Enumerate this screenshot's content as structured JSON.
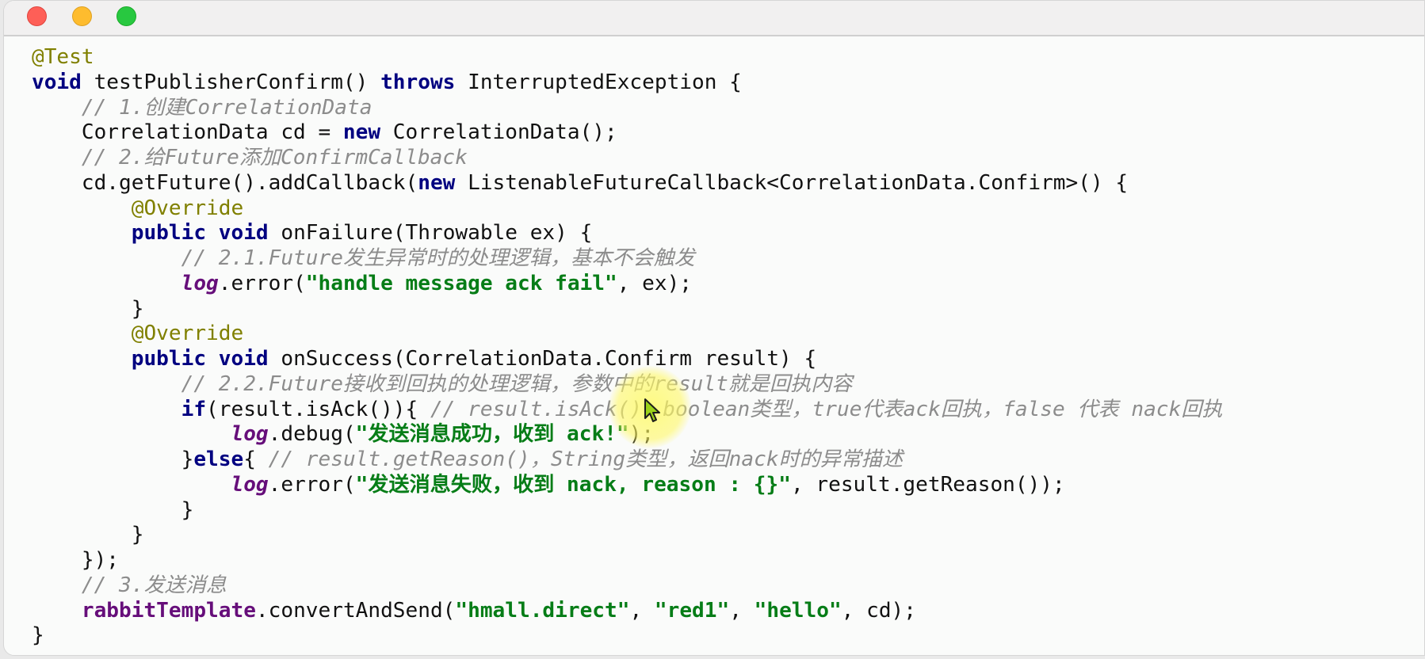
{
  "window": {
    "controls": [
      "close",
      "minimize",
      "maximize"
    ],
    "colors": {
      "close": "#fe5f57",
      "minimize": "#febc2e",
      "maximize": "#28c840"
    }
  },
  "code": {
    "language": "java",
    "lines": [
      [
        {
          "t": "ann",
          "v": "@Test"
        }
      ],
      [
        {
          "t": "kw",
          "v": "void"
        },
        {
          "t": "",
          "v": " testPublisherConfirm() "
        },
        {
          "t": "kw",
          "v": "throws"
        },
        {
          "t": "",
          "v": " InterruptedException {"
        }
      ],
      [
        {
          "t": "",
          "v": "    "
        },
        {
          "t": "cm",
          "v": "// 1.创建CorrelationData"
        }
      ],
      [
        {
          "t": "",
          "v": "    CorrelationData cd = "
        },
        {
          "t": "kw",
          "v": "new"
        },
        {
          "t": "",
          "v": " CorrelationData();"
        }
      ],
      [
        {
          "t": "",
          "v": "    "
        },
        {
          "t": "cm",
          "v": "// 2.给Future添加ConfirmCallback"
        }
      ],
      [
        {
          "t": "",
          "v": "    cd.getFuture().addCallback("
        },
        {
          "t": "kw",
          "v": "new"
        },
        {
          "t": "",
          "v": " ListenableFutureCallback<CorrelationData.Confirm>() {"
        }
      ],
      [
        {
          "t": "",
          "v": "        "
        },
        {
          "t": "ann",
          "v": "@Override"
        }
      ],
      [
        {
          "t": "",
          "v": "        "
        },
        {
          "t": "kw",
          "v": "public"
        },
        {
          "t": "",
          "v": " "
        },
        {
          "t": "kw",
          "v": "void"
        },
        {
          "t": "",
          "v": " onFailure(Throwable ex) {"
        }
      ],
      [
        {
          "t": "",
          "v": "            "
        },
        {
          "t": "cm",
          "v": "// 2.1.Future发生异常时的处理逻辑，基本不会触发"
        }
      ],
      [
        {
          "t": "",
          "v": "            "
        },
        {
          "t": "fld it",
          "v": "log"
        },
        {
          "t": "",
          "v": ".error("
        },
        {
          "t": "str",
          "v": "\"handle message ack fail\""
        },
        {
          "t": "",
          "v": ", ex);"
        }
      ],
      [
        {
          "t": "",
          "v": "        }"
        }
      ],
      [
        {
          "t": "",
          "v": "        "
        },
        {
          "t": "ann",
          "v": "@Override"
        }
      ],
      [
        {
          "t": "",
          "v": "        "
        },
        {
          "t": "kw",
          "v": "public"
        },
        {
          "t": "",
          "v": " "
        },
        {
          "t": "kw",
          "v": "void"
        },
        {
          "t": "",
          "v": " onSuccess(CorrelationData.Confirm result) {"
        }
      ],
      [
        {
          "t": "",
          "v": "            "
        },
        {
          "t": "cm",
          "v": "// 2.2.Future接收到回执的处理逻辑，参数中的result就是回执内容"
        }
      ],
      [
        {
          "t": "",
          "v": "            "
        },
        {
          "t": "kw",
          "v": "if"
        },
        {
          "t": "",
          "v": "(result.isAck()){ "
        },
        {
          "t": "cm",
          "v": "// result.isAck()，boolean类型，true代表ack回执，false 代表 nack回执"
        }
      ],
      [
        {
          "t": "",
          "v": "                "
        },
        {
          "t": "fld it",
          "v": "log"
        },
        {
          "t": "",
          "v": ".debug("
        },
        {
          "t": "str",
          "v": "\"发送消息成功，收到 ack!\""
        },
        {
          "t": "",
          "v": ");"
        }
      ],
      [
        {
          "t": "",
          "v": "            }"
        },
        {
          "t": "kw",
          "v": "else"
        },
        {
          "t": "",
          "v": "{ "
        },
        {
          "t": "cm",
          "v": "// result.getReason()，String类型，返回nack时的异常描述"
        }
      ],
      [
        {
          "t": "",
          "v": "                "
        },
        {
          "t": "fld it",
          "v": "log"
        },
        {
          "t": "",
          "v": ".error("
        },
        {
          "t": "str",
          "v": "\"发送消息失败，收到 nack, reason : {}\""
        },
        {
          "t": "",
          "v": ", result.getReason());"
        }
      ],
      [
        {
          "t": "",
          "v": "            }"
        }
      ],
      [
        {
          "t": "",
          "v": "        }"
        }
      ],
      [
        {
          "t": "",
          "v": "    });"
        }
      ],
      [
        {
          "t": "",
          "v": "    "
        },
        {
          "t": "cm",
          "v": "// 3.发送消息"
        }
      ],
      [
        {
          "t": "",
          "v": "    "
        },
        {
          "t": "fld",
          "v": "rabbitTemplate"
        },
        {
          "t": "",
          "v": ".convertAndSend("
        },
        {
          "t": "str",
          "v": "\"hmall.direct\""
        },
        {
          "t": "",
          "v": ", "
        },
        {
          "t": "str",
          "v": "\"red1\""
        },
        {
          "t": "",
          "v": ", "
        },
        {
          "t": "str",
          "v": "\"hello\""
        },
        {
          "t": "",
          "v": ", cd);"
        }
      ],
      [
        {
          "t": "",
          "v": "}"
        }
      ]
    ]
  },
  "cursor": {
    "type": "arrow",
    "highlight": "yellow-halo"
  }
}
